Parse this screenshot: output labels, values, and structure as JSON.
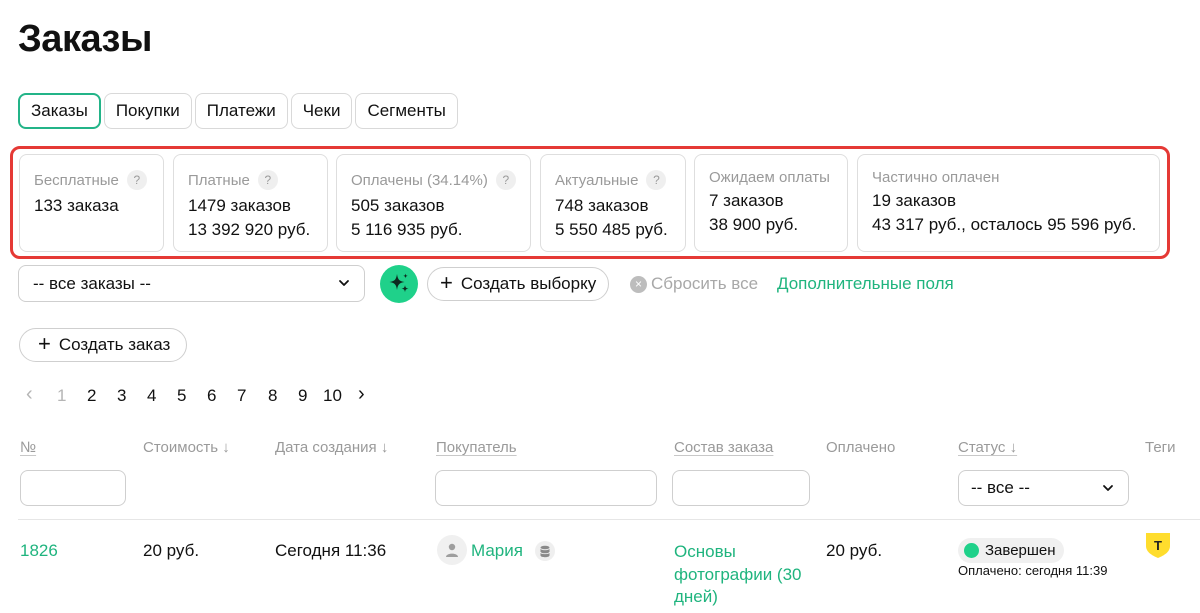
{
  "page": {
    "title": "Заказы"
  },
  "tabs": [
    {
      "label": "Заказы",
      "active": true
    },
    {
      "label": "Покупки"
    },
    {
      "label": "Платежи"
    },
    {
      "label": "Чеки"
    },
    {
      "label": "Сегменты"
    }
  ],
  "stats": [
    {
      "label": "Бесплатные",
      "lines": [
        "133 заказа"
      ],
      "help": "?"
    },
    {
      "label": "Платные",
      "lines": [
        "1479 заказов",
        "13 392 920 руб."
      ],
      "help": "?"
    },
    {
      "label": "Оплачены (34.14%)",
      "lines": [
        "505 заказов",
        "5 116 935 руб."
      ],
      "help": "?"
    },
    {
      "label": "Актуальные",
      "lines": [
        "748 заказов",
        "5 550 485 руб."
      ],
      "help": "?"
    },
    {
      "label": "Ожидаем оплаты",
      "lines": [
        "7 заказов",
        "38 900 руб."
      ]
    },
    {
      "label": "Частично оплачен",
      "lines": [
        "19 заказов",
        "43 317 руб., осталось 95 596 руб."
      ]
    }
  ],
  "filters": {
    "orders_select": "-- все заказы --",
    "create_selection": "Создать выборку",
    "reset_all": "Сбросить все",
    "extra_fields": "Дополнительные поля",
    "plus": "+",
    "reset_x": "×"
  },
  "actions": {
    "create_order": "Создать заказ",
    "plus": "+"
  },
  "pagination": {
    "prev": "‹",
    "next": "›",
    "pages": [
      "1",
      "2",
      "3",
      "4",
      "5",
      "6",
      "7",
      "8",
      "9",
      "10"
    ],
    "current": "1"
  },
  "table": {
    "headers": {
      "number": "№",
      "cost": "Стоимость ↓",
      "created": "Дата создания ↓",
      "buyer": "Покупатель",
      "composition": "Состав заказа",
      "paid": "Оплачено",
      "status": "Статус ↓",
      "tags": "Теги"
    },
    "status_filter": "-- все --",
    "rows": [
      {
        "number": "1826",
        "cost": "20 руб.",
        "created": "Сегодня 11:36",
        "buyer": "Мария",
        "composition": "Основы фотографии (30 дней)",
        "paid": "20 руб.",
        "status": "Завершен",
        "paid_note": "Оплачено: сегодня 11:39",
        "tag_icon": "tinkoff-t-icon",
        "tag_letter": "T"
      }
    ]
  },
  "colors": {
    "accent": "#1fb47e",
    "accent_bright": "#1fd18a",
    "highlight": "#e53935",
    "tag_yellow": "#ffdd2d"
  }
}
